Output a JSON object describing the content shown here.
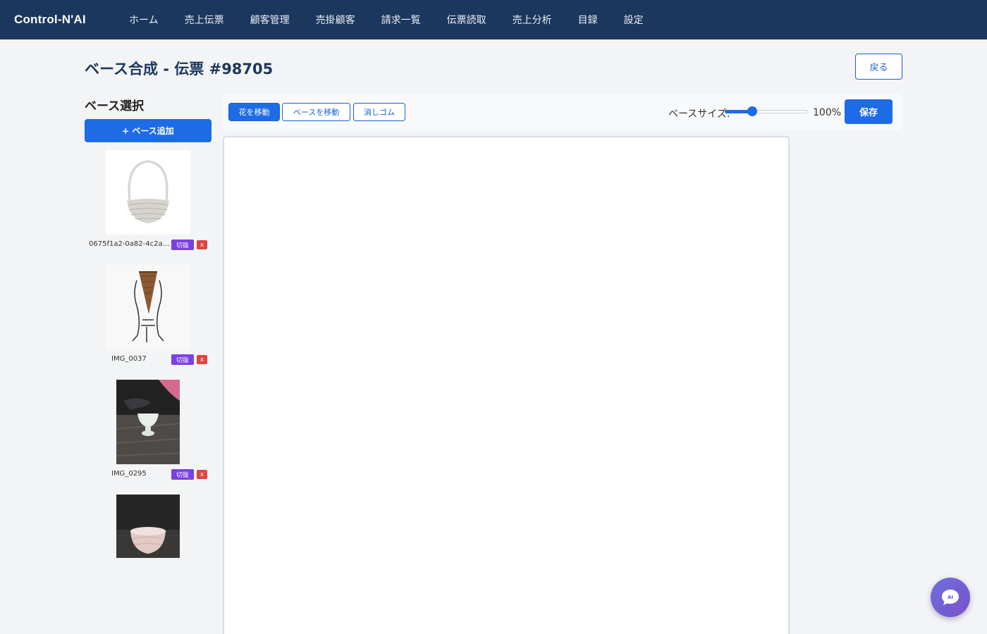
{
  "nav": {
    "brand": "Control-N'AI",
    "items": [
      "ホーム",
      "売上伝票",
      "顧客管理",
      "売掛顧客",
      "請求一覧",
      "伝票読取",
      "売上分析",
      "目録",
      "設定"
    ]
  },
  "header": {
    "title": "ベース合成 - 伝票 #98705",
    "back_label": "戻る"
  },
  "sidebar": {
    "title": "ベース選択",
    "add_label": "+ ベース追加",
    "items": [
      {
        "name": "0675f1a2-0a82-4c2a-...",
        "cut_label": "切抜",
        "delete_label": "x"
      },
      {
        "name": "IMG_0037",
        "cut_label": "切抜",
        "delete_label": "x"
      },
      {
        "name": "IMG_0295",
        "cut_label": "切抜",
        "delete_label": "x"
      }
    ]
  },
  "toolbar": {
    "tools": [
      "花を移動",
      "ベースを移動",
      "消しゴム"
    ],
    "active_tool": "花を移動",
    "size_label": "ベースサイズ:",
    "size_value": "100%",
    "slider_fraction": 0.33,
    "save_label": "保存"
  },
  "ai_fab": {
    "label": "AI"
  },
  "colors": {
    "nav_bg": "#1c375d",
    "primary": "#1e6be6",
    "cut_badge": "#7b3fe4",
    "delete_badge": "#e04343"
  }
}
